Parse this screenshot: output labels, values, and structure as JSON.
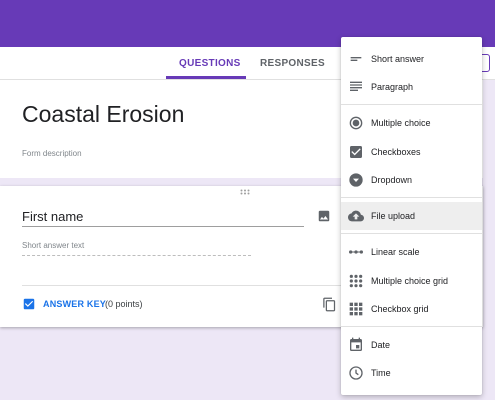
{
  "tabs": {
    "questions": "QUESTIONS",
    "responses": "RESPONSES"
  },
  "header_chip": "D",
  "form": {
    "title": "Coastal Erosion",
    "description": "Form description"
  },
  "question": {
    "title": "First name",
    "placeholder": "Short answer text",
    "answer_key_label": "ANSWER KEY",
    "points": "(0 points)"
  },
  "menu": {
    "items": [
      {
        "label": "Short answer",
        "icon": "short-answer-icon"
      },
      {
        "label": "Paragraph",
        "icon": "paragraph-icon"
      },
      {
        "label": "Multiple choice",
        "icon": "radio-icon"
      },
      {
        "label": "Checkboxes",
        "icon": "checkbox-icon"
      },
      {
        "label": "Dropdown",
        "icon": "dropdown-icon"
      },
      {
        "label": "File upload",
        "icon": "cloud-upload-icon",
        "highlighted": true
      },
      {
        "label": "Linear scale",
        "icon": "linear-scale-icon"
      },
      {
        "label": "Multiple choice grid",
        "icon": "grid-icon"
      },
      {
        "label": "Checkbox grid",
        "icon": "grid-icon"
      },
      {
        "label": "Date",
        "icon": "calendar-icon"
      },
      {
        "label": "Time",
        "icon": "clock-icon"
      }
    ]
  },
  "colors": {
    "brand": "#673ab7",
    "background": "#ede7f6",
    "accent_blue": "#1a73e8"
  }
}
